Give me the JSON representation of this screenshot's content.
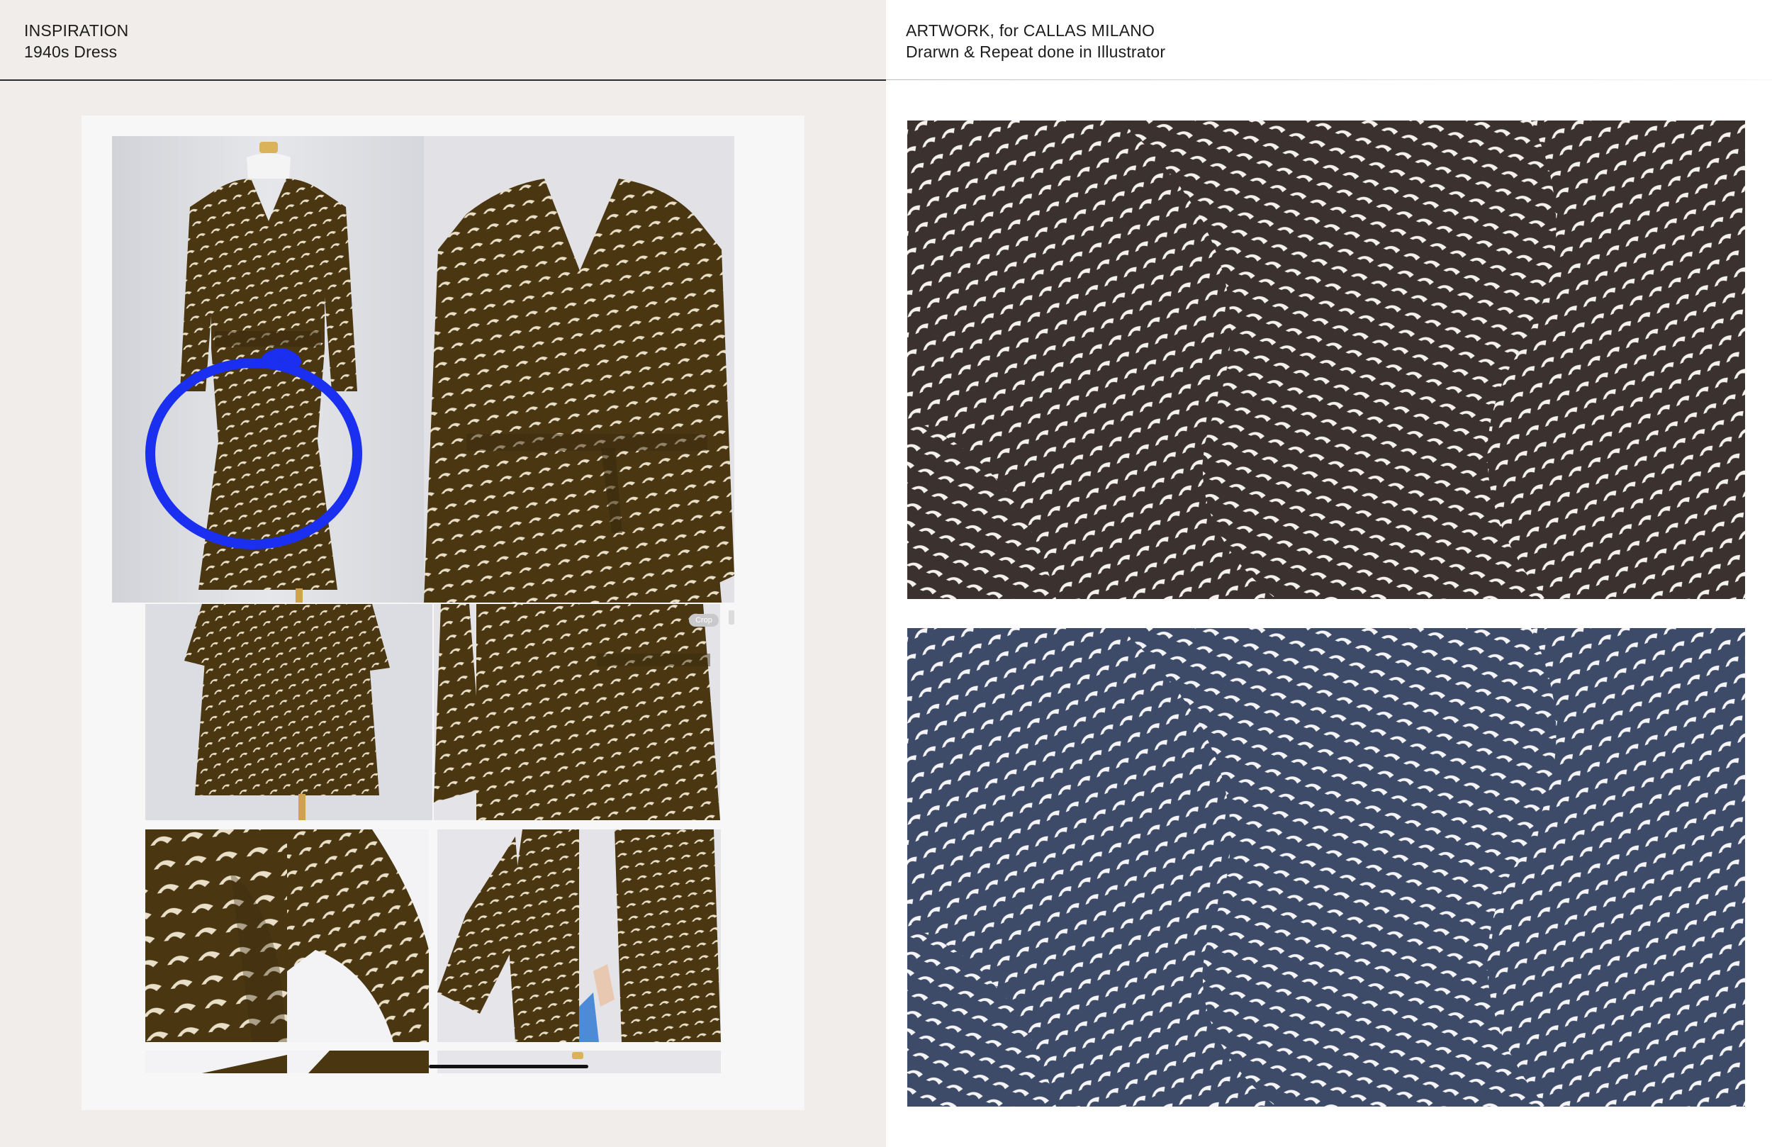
{
  "left": {
    "heading_line1": "INSPIRATION",
    "heading_line2": "1940s Dress"
  },
  "right": {
    "heading_line1": "ARTWORK, for CALLAS MILANO",
    "heading_line2": "Drarwn & Repeat done in Illustrator"
  },
  "board": {
    "crop_label": "Crop"
  },
  "colors": {
    "left_background": "#f0edea",
    "dress_brown": "#4a3712",
    "motif_cream": "#e9dfc8",
    "swatch_brown": "#3b3230",
    "swatch_navy": "#3e4b68",
    "annotation_blue": "#1a2ff0"
  }
}
